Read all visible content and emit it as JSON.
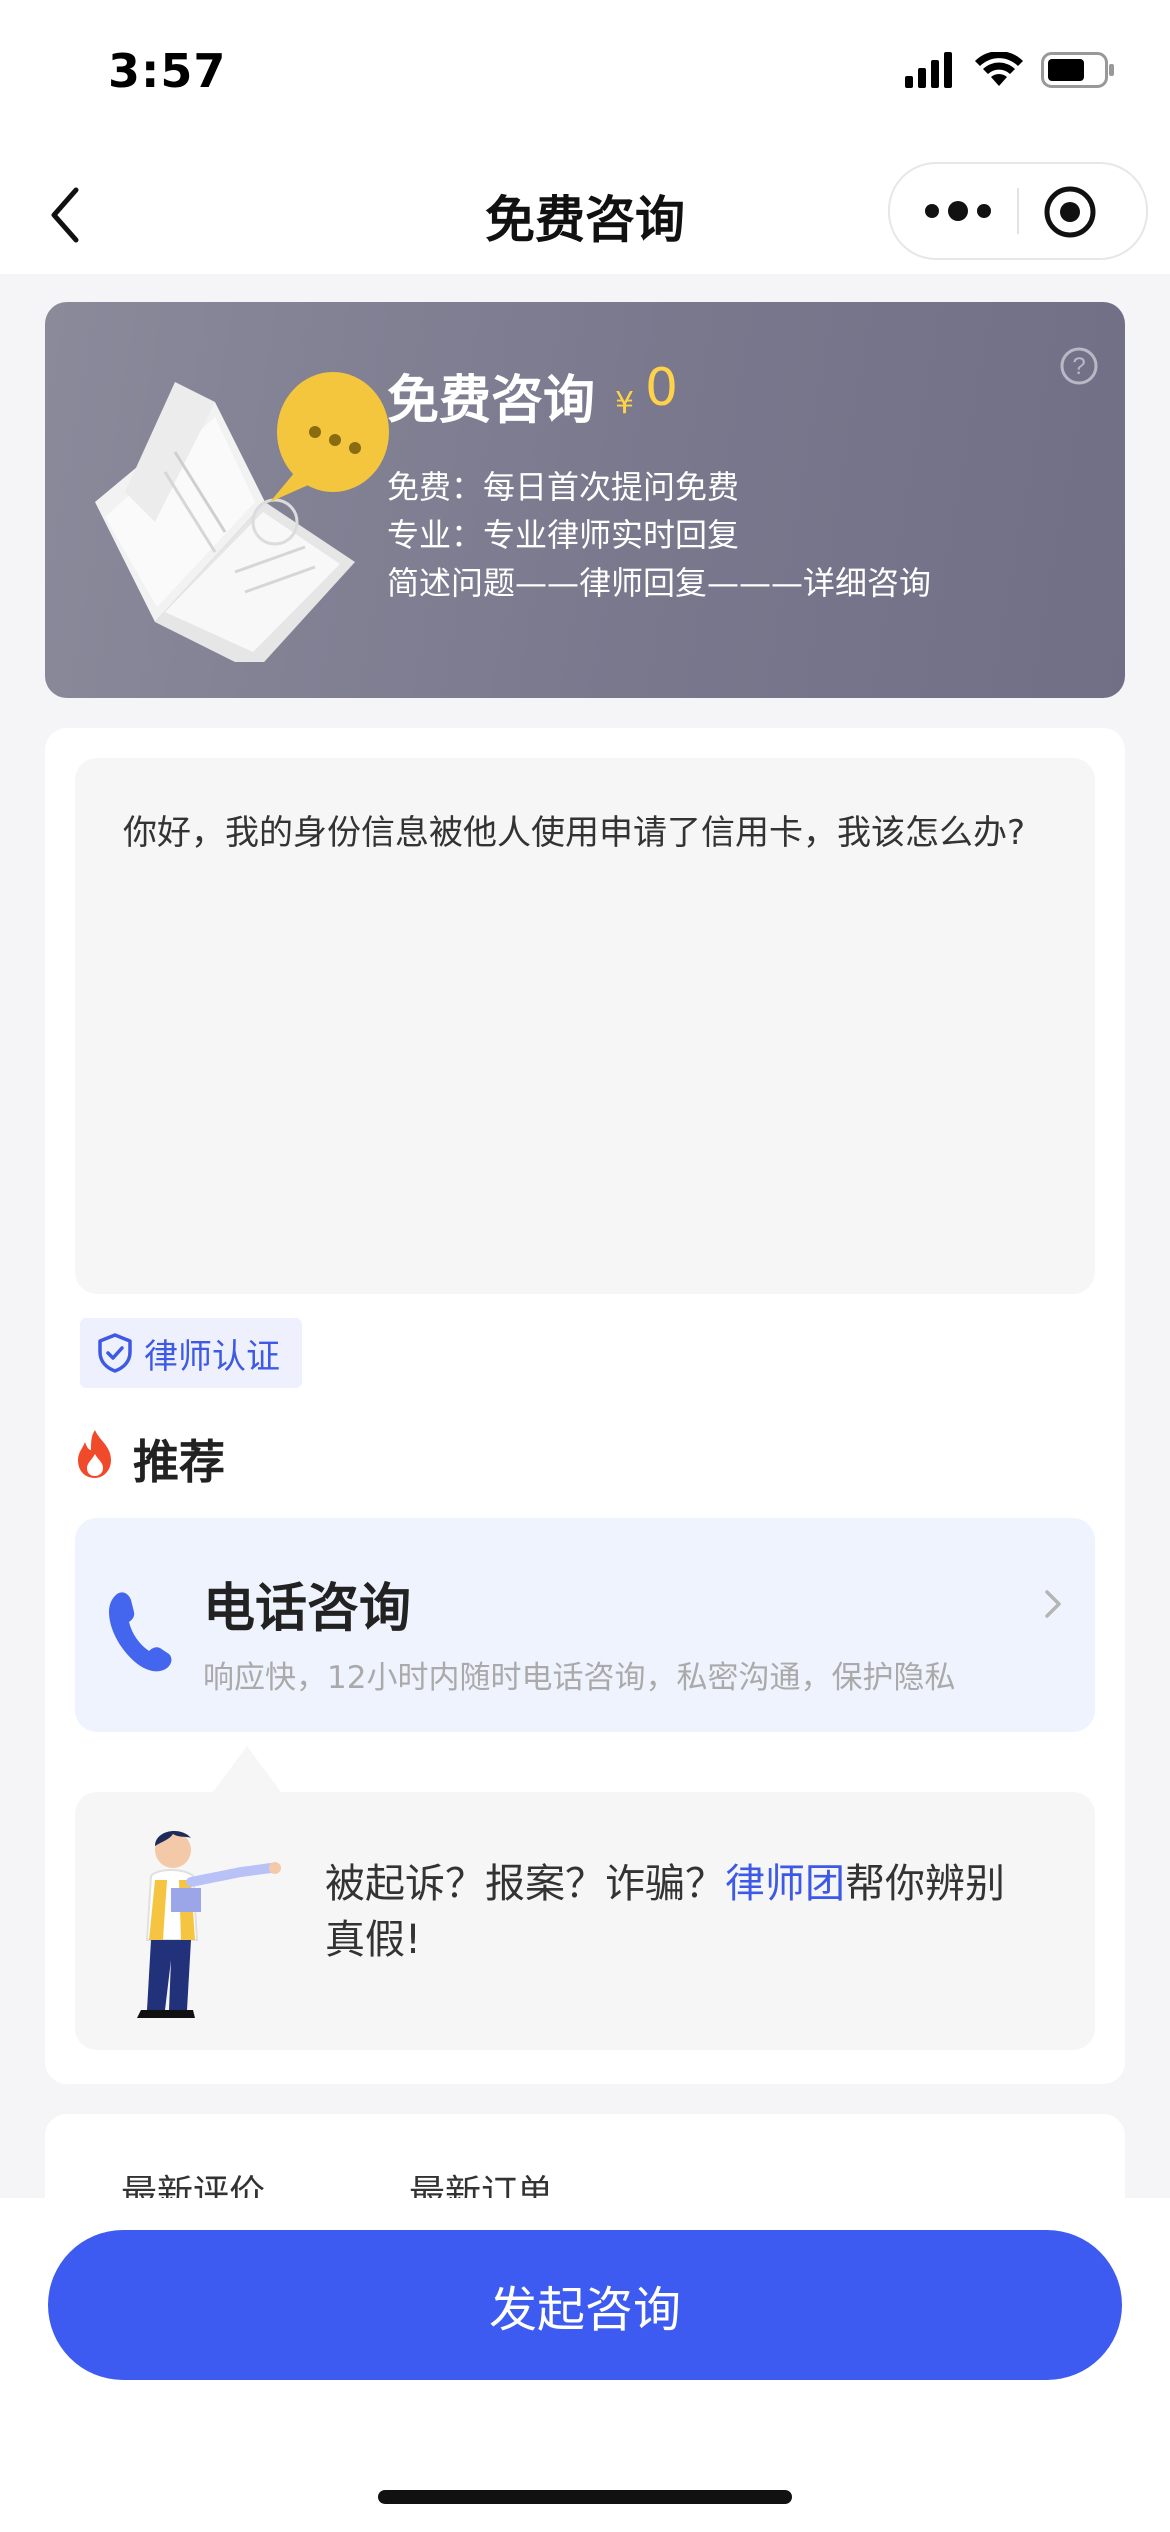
{
  "status_bar": {
    "time": "3:57"
  },
  "nav": {
    "title": "免费咨询"
  },
  "banner": {
    "title": "免费咨询",
    "price_symbol": "¥",
    "price_value": "0",
    "features": [
      "免费：每日首次提问免费",
      "专业：专业律师实时回复",
      "简述问题——律师回复———详细咨询"
    ]
  },
  "question": {
    "text": "你好，我的身份信息被他人使用申请了信用卡，我该怎么办?"
  },
  "badge": {
    "label": "律师认证"
  },
  "recommend": {
    "title": "推荐",
    "phone_card": {
      "title": "电话咨询",
      "desc": "响应快，12小时内随时电话咨询，私密沟通，保护隐私"
    },
    "tip": {
      "part1": "被起诉？报案？诈骗？",
      "highlight": "律师团",
      "part2": "帮你辨别真假!"
    }
  },
  "tabs": [
    "最新评价",
    "最新订单"
  ],
  "cta": {
    "label": "发起咨询"
  },
  "colors": {
    "accent": "#3d5bf0",
    "price": "#ffd24a",
    "banner": "#7a788d"
  }
}
